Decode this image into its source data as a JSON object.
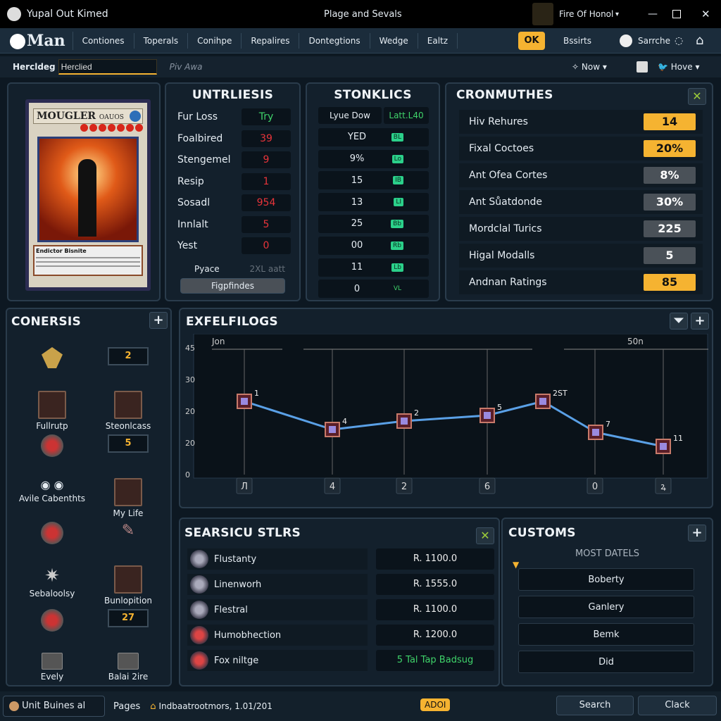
{
  "window": {
    "app_title": "Yupal Out Kimed",
    "center_title": "Plage and Sevals",
    "profile": "Fire Of Honol"
  },
  "nav": {
    "logo": "Man",
    "items": [
      "Contiones",
      "Toperals",
      "Conihpe",
      "Repalires",
      "Dontegtions",
      "Wedge",
      "Ealtz"
    ],
    "ok": "OK",
    "results": "Bssirts",
    "search": "Sarrche"
  },
  "subbar": {
    "label": "Hercldeg",
    "input_value": "Herclied",
    "hint": "Piv Awa",
    "now": "Now",
    "hove": "Hove"
  },
  "card": {
    "name": "MOUGLER",
    "subname": "OAUOS",
    "stars": 7,
    "type_line": "Endictor Bisnite"
  },
  "untrliesis": {
    "title": "UNTRLIESIS",
    "rows": [
      {
        "label": "Fur Loss",
        "value": "Try"
      },
      {
        "label": "Foalbired",
        "value": "39"
      },
      {
        "label": "Stengemel",
        "value": "9"
      },
      {
        "label": "Resip",
        "value": "1"
      },
      {
        "label": "Sosadl",
        "value": "954"
      },
      {
        "label": "Innlalt",
        "value": "5"
      },
      {
        "label": "Yest",
        "value": "0"
      }
    ],
    "footer_label": "Pyace",
    "footer_value": "2XL aatt",
    "button": "Figpfindes"
  },
  "stonklics": {
    "title": "STONKLICS",
    "header_label": "Lyue Dow",
    "header_value": "Latt.L40",
    "rows": [
      {
        "value": "YED",
        "tag": "BL"
      },
      {
        "value": "9%",
        "tag": "Lo"
      },
      {
        "value": "15",
        "tag": "IB"
      },
      {
        "value": "13",
        "tag": "LI"
      },
      {
        "value": "25",
        "tag": "Bb"
      },
      {
        "value": "00",
        "tag": "Rb"
      },
      {
        "value": "11",
        "tag": "Lb"
      },
      {
        "value": "0",
        "tag": "VL"
      }
    ]
  },
  "cronmuthes": {
    "title": "CRONMUTHES",
    "rows": [
      {
        "label": "Hiv Rehures",
        "value": "14",
        "style": "gold"
      },
      {
        "label": "Fixal Coctoes",
        "value": "20%",
        "style": "gold"
      },
      {
        "label": "Ant Ofea Cortes",
        "value": "8%",
        "style": "grey"
      },
      {
        "label": "Ant Sůatdonde",
        "value": "30%",
        "style": "grey"
      },
      {
        "label": "Mordclal Turics",
        "value": "225",
        "style": "grey"
      },
      {
        "label": "Higal Modalls",
        "value": "5",
        "style": "grey"
      },
      {
        "label": "Andnan Ratings",
        "value": "85",
        "style": "gold"
      }
    ]
  },
  "conersis": {
    "title": "CONERSIS",
    "items": [
      {
        "type": "emblem",
        "label": ""
      },
      {
        "type": "counter",
        "label": "",
        "value": "2"
      },
      {
        "type": "box",
        "label": "Fullrutp"
      },
      {
        "type": "box",
        "label": "Steonlcass"
      },
      {
        "type": "round",
        "label": ""
      },
      {
        "type": "counter",
        "label": "",
        "value": "5"
      },
      {
        "type": "toggle",
        "label": "Avile Cabenthts"
      },
      {
        "type": "box",
        "label": "My Life"
      },
      {
        "type": "round",
        "label": ""
      },
      {
        "type": "feather",
        "label": ""
      },
      {
        "type": "burst",
        "label": "Sebaloolsy"
      },
      {
        "type": "box",
        "label": "Bunlopition"
      },
      {
        "type": "round",
        "label": ""
      },
      {
        "type": "counter",
        "label": "",
        "value": "27"
      },
      {
        "type": "small",
        "label": "Evely"
      },
      {
        "type": "small",
        "label": "Balai 2ire"
      }
    ]
  },
  "exfelfilogs": {
    "title": "EXFELFILOGS",
    "left_label": "Jon",
    "right_label": "50n",
    "chart_data": {
      "type": "line",
      "yticks": [
        "45",
        "30",
        "20",
        "20",
        "0"
      ],
      "ylim": [
        0,
        45
      ],
      "points": [
        {
          "value": 26,
          "label": "1"
        },
        {
          "value": 16,
          "label": "4"
        },
        {
          "value": 19,
          "label": "2"
        },
        {
          "value": 21,
          "label": "5"
        },
        {
          "value": 26,
          "label": "2ST"
        },
        {
          "value": 15,
          "label": "7"
        },
        {
          "value": 10,
          "label": "11"
        }
      ],
      "bottom_labels": [
        "Л",
        "4",
        "2",
        "6",
        "0",
        "ꝝ"
      ],
      "line_color": "#5aa0e6"
    }
  },
  "search_stars": {
    "title": "SEARSICU STLRS",
    "rows": [
      {
        "name": "Flustanty",
        "value": "R. 1100.0"
      },
      {
        "name": "Linenworh",
        "value": "R. 1555.0"
      },
      {
        "name": "Flestral",
        "value": "R. 1100.0"
      },
      {
        "name": "Humobhection",
        "value": "R. 1200.0"
      },
      {
        "name": "Fox niltge",
        "value": "5 Tal Tap Badsug",
        "highlight": true
      }
    ]
  },
  "customs": {
    "title": "CUSTOMS",
    "subtitle": "MOST DATELS",
    "items": [
      "Boberty",
      "Ganlery",
      "Bemk",
      "Did"
    ]
  },
  "footer": {
    "app": "Unit Buines al",
    "pages": "Pages",
    "status": "Indbaatrootmors, 1.01/201",
    "badge": "ADOI",
    "search": "Search",
    "clack": "Clack"
  }
}
